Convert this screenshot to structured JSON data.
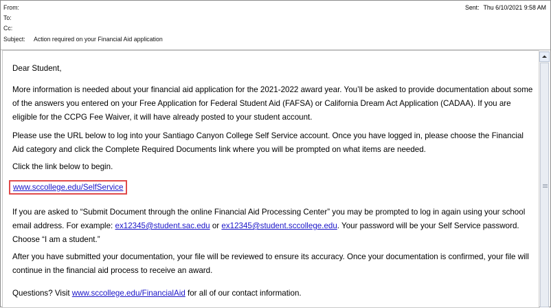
{
  "header": {
    "from_label": "From:",
    "to_label": "To:",
    "cc_label": "Cc:",
    "subject_label": "Subject:",
    "subject_value": "Action required on your Financial Aid application",
    "sent_label": "Sent:",
    "sent_value": "Thu 6/10/2021 9:58 AM"
  },
  "body": {
    "greeting": "Dear Student,",
    "p1": "More information is needed about your financial aid application for the 2021-2022 award year. You’ll be asked to provide documentation about some of the answers you entered on your Free Application for Federal Student Aid (FAFSA) or California Dream Act Application (CADAA).  If you are eligible for the CCPG Fee Waiver, it will have already posted to your student account.",
    "p2": "Please use the URL below to log into your Santiago Canyon College Self Service account. Once you have logged in, please choose the Financial Aid category and click the Complete Required Documents link where you will be prompted on what items are needed.",
    "p3": "Click the link below to begin.",
    "self_service_link": "www.sccollege.edu/SelfService",
    "p4_a": "If you are asked to “Submit Document through the online Financial Aid Processing Center” you may be prompted to log in again using your school email address. For example: ",
    "email1": "ex12345@student.sac.edu",
    "p4_or": " or ",
    "email2": "ex12345@student.sccollege.edu",
    "p4_b": ". Your password will be your Self Service password. Choose “I am a student.”",
    "p5": "After you have submitted your documentation, your file will be reviewed to ensure its accuracy. Once your documentation is confirmed, your file will continue in the financial aid process to receive an award.",
    "p6_a": "Questions? Visit ",
    "financial_aid_link": "www.sccollege.edu/FinancialAid",
    "p6_b": " for all of our contact information."
  }
}
